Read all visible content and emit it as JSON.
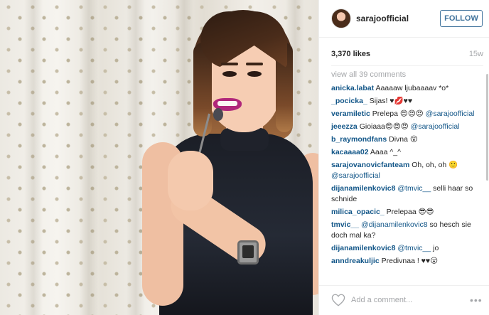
{
  "post": {
    "username": "sarajoofficial",
    "follow_label": "FOLLOW",
    "likes": "3,370 likes",
    "age": "15w",
    "view_all": "view all 39 comments",
    "comments": [
      {
        "user": "anicka.labat",
        "text": "Aaaaaw ljubaaaav *o*"
      },
      {
        "user": "_pocicka_",
        "text": "Sijas! ♥💋♥♥"
      },
      {
        "user": "veramiletic",
        "text": "Prelepa 😍😍😍 ",
        "mention": "@sarajoofficial"
      },
      {
        "user": "jeeezza",
        "text": "Gioiaaa😍😍😍 ",
        "mention": "@sarajoofficial"
      },
      {
        "user": "b_raymondfans",
        "text": "Divna 😮"
      },
      {
        "user": "kacaaaa02",
        "text": "Aaaa ^_^"
      },
      {
        "user": "sarajovanovicfanteam",
        "text": "Oh, oh, oh 🙂 ",
        "mention": "@sarajoofficial"
      },
      {
        "user": "dijanamilenkovic8",
        "mention": "@tmvic__",
        "text": " selli haar so schnide"
      },
      {
        "user": "milica_opacic_",
        "text": "Prelepaa 😎😎"
      },
      {
        "user": "tmvic__",
        "mention": "@dijanamilenkovic8",
        "text": " so hesch sie doch mal ka?"
      },
      {
        "user": "dijanamilenkovic8",
        "mention": "@tmvic__",
        "text": " jo"
      },
      {
        "user": "anndreakuljic",
        "text": "Predivnaa ! ♥♥😮"
      }
    ],
    "add_comment_placeholder": "Add a comment...",
    "more_label": "•••"
  },
  "colors": {
    "link": "#125688",
    "follow_blue": "#3f729b",
    "muted": "#a5a7aa"
  },
  "icons": {
    "like": "heart-icon",
    "more": "more-options-icon"
  }
}
